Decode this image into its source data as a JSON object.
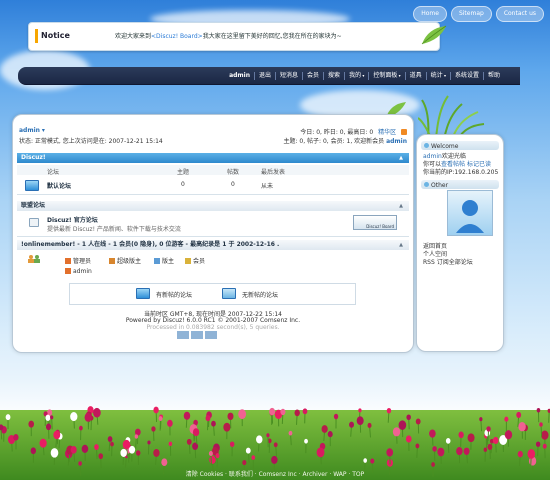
{
  "topnav": [
    "Home",
    "Sitemap",
    "Contact us"
  ],
  "notice": {
    "label": "Notice",
    "text_before": "欢迎大家来到",
    "text_link": "<Discuz! Board>",
    "text_after": "我大家在这里留下美好的回忆,您我在所在的家块为~"
  },
  "mainnav": [
    {
      "label": "admin",
      "bold": true
    },
    {
      "label": "退出"
    },
    {
      "label": "短消息"
    },
    {
      "label": "会员"
    },
    {
      "label": "搜索"
    },
    {
      "label": "我的",
      "arrow": true
    },
    {
      "label": "控制面板",
      "arrow": true
    },
    {
      "label": "道具"
    },
    {
      "label": "统计",
      "arrow": true
    },
    {
      "label": "系统设置"
    },
    {
      "label": "帮助"
    }
  ],
  "user": {
    "name": "admin",
    "status": "状态: 正常模式, 您上次访问是在: 2007-12-21 15:14",
    "today": "今日: 0, 昨日: 0, 最高日: 0",
    "essence": "精华区",
    "totals_prefix": "主题: 0, 帖子: 0, 会员: 1, 欢迎新会员",
    "newest": "admin"
  },
  "forum_section": {
    "title": "Discuz!",
    "columns": [
      "论坛",
      "主题",
      "帖数",
      "最后发表"
    ],
    "forums": [
      {
        "name": "默认论坛",
        "topics": "0",
        "posts": "0",
        "last": "从未"
      }
    ]
  },
  "links_section": {
    "title": "联盟论坛",
    "name": "Discuz! 官方论坛",
    "desc": "提供最新  Discuz! 产品新闻、软件下载与技术交流",
    "banner": "Discuz! Board"
  },
  "online": {
    "title": "!onlinemember! - 1 人在线 - 1 会员(0 隐身), 0 位游客 - 最高纪录是 1 于 2002-12-16 .",
    "roles": [
      "管理员",
      "超级版主",
      "版主",
      "会员"
    ],
    "members": [
      "admin"
    ]
  },
  "legend": {
    "new": "有新帖的论坛",
    "none": "无新帖的论坛"
  },
  "footer": {
    "timezone": "当前时区  GMT+8, 现在时间是  2007-12-22 15:14",
    "powered": "Powered by  Discuz!  6.0.0 RC1  © 2001-2007 Comsenz Inc.",
    "processed": "Processed in 0.083982 second(s), 5 queries.",
    "links": "清除 Cookies · 联系我们 · Comsenz Inc · Archiver · WAP · TOP"
  },
  "sidebar": {
    "welcome_title": "Welcome",
    "welcome_user": "admin",
    "welcome_suffix": "欢迎光临",
    "pm_prefix": "你可以",
    "pm_view": "查看帖帖",
    "pm_mark": "标记已读",
    "ip": "你当前的IP:192.168.0.205",
    "other_title": "Other",
    "links": [
      "返回首页",
      "个人空间",
      "RSS 订阅全部论坛"
    ]
  }
}
